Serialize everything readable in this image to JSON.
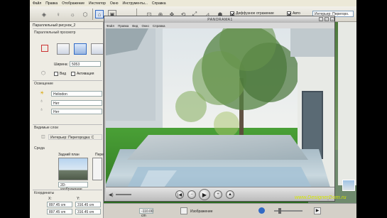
{
  "menubar": {
    "items": [
      "Файл",
      "Правка",
      "Отображение",
      "Инстектор",
      "Окно",
      "Инструменты...",
      "Справка"
    ]
  },
  "toolbar": {
    "diffuse_label": "Диффузное отражение",
    "auto_label": "Авто",
    "dropdown_value": "Интерьер: Перегоро."
  },
  "left_panel": {
    "title": "Параллельный рисунок_2",
    "section_parallel": "Параллельный просмотр",
    "width_label": "Ширина:",
    "width_value": "5053",
    "check_view": "Вид",
    "check_activation": "Активация",
    "lighting_label": "Освещение",
    "light_source": "Heliodon",
    "option_no_1": "Нет",
    "option_no_2": "Нет",
    "visible_layers_label": "Видимые слои",
    "layer_value": "Интерьер: Перегородка: С",
    "environment_label": "Среда",
    "background_label": "Задний план",
    "foreground_label": "Пере",
    "image_dropdown": "2D-изображение",
    "coordinates_label": "Координаты",
    "x_label": "X:",
    "y_label": "Y:",
    "x1": "897.45 cm",
    "y1": "316.45 cm",
    "x2": "897.45 cm",
    "y2": "316.45 cm",
    "z_value": "-110.00 cm"
  },
  "panorama_window": {
    "title": "PANORAMA1",
    "menu": [
      "Файл",
      "Правка",
      "Вид",
      "Окно",
      "Справка"
    ]
  },
  "statusbar": {
    "preview_label": "Изображение"
  },
  "watermark": "www.DesignerDom.ru",
  "colors": {
    "accent": "#316ac5",
    "watermark": "#d7e600",
    "grass": "#3f8c2e"
  }
}
